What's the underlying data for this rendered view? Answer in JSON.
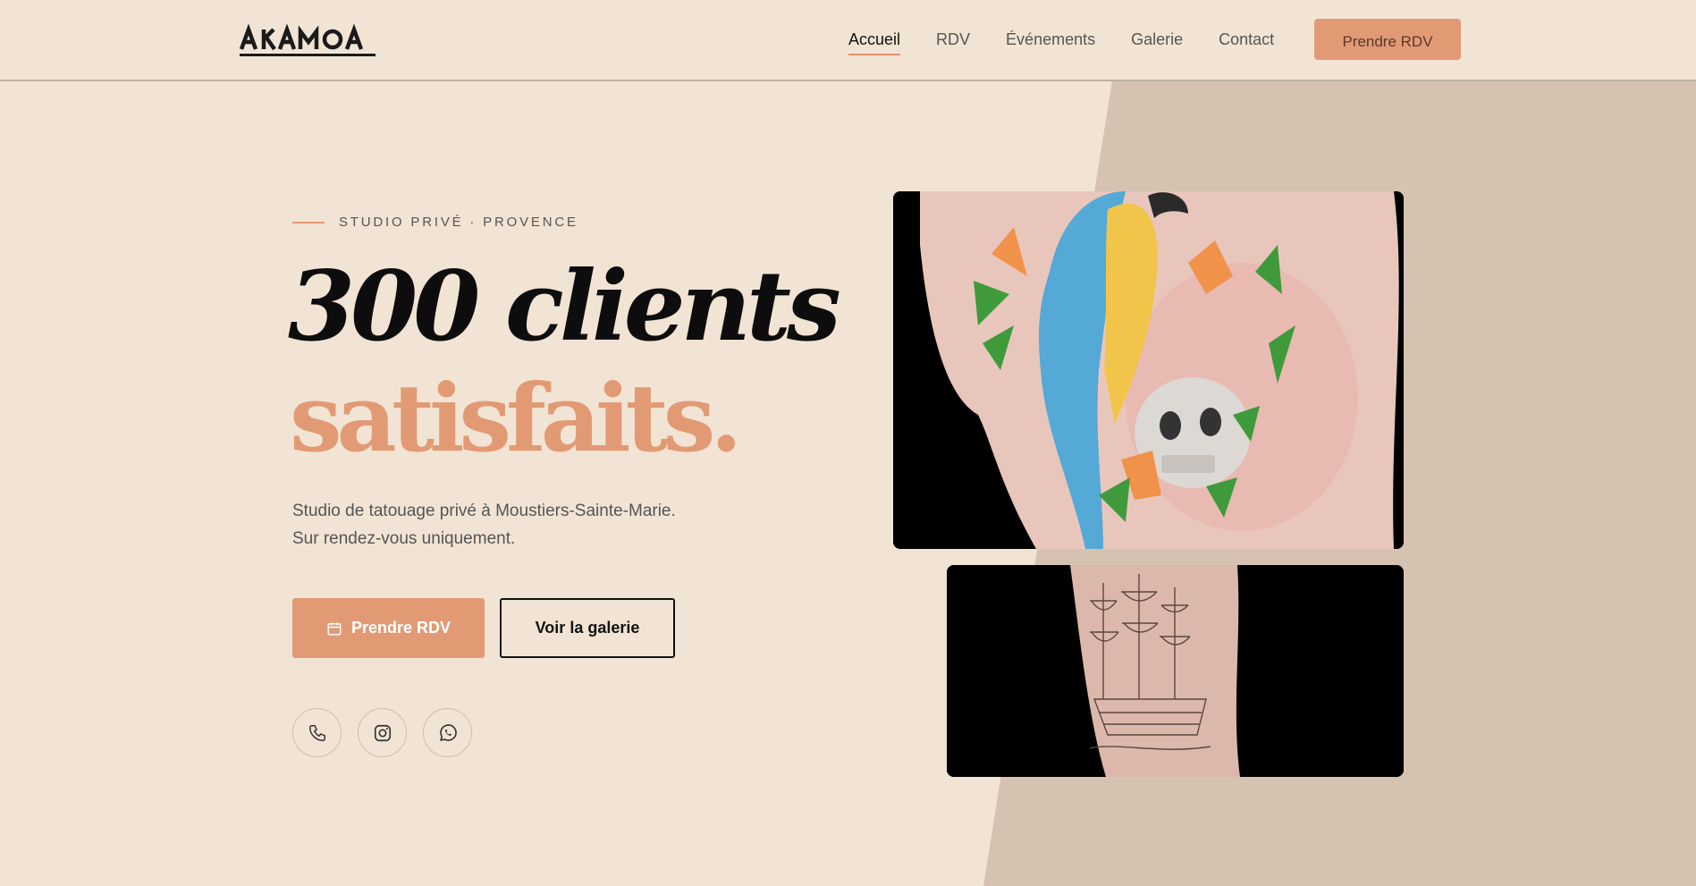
{
  "brand": {
    "logo_text": "AKAMOA"
  },
  "nav": {
    "items": [
      {
        "label": "Accueil",
        "active": true
      },
      {
        "label": "RDV"
      },
      {
        "label": "Événements"
      },
      {
        "label": "Galerie"
      },
      {
        "label": "Contact"
      }
    ],
    "cta_label": "Prendre RDV"
  },
  "hero": {
    "eyebrow": "STUDIO PRIVÉ · PROVENCE",
    "headline_line1": "300 clients",
    "headline_line2": "satisfaits.",
    "description_line1": "Studio de tatouage privé à Moustiers-Sainte-Marie.",
    "description_line2": "Sur rendez-vous uniquement.",
    "primary_button": {
      "label": "Prendre RDV",
      "icon": "calendar-icon"
    },
    "secondary_button": {
      "label": "Voir la galerie"
    },
    "socials": [
      {
        "icon": "phone-icon"
      },
      {
        "icon": "instagram-icon"
      },
      {
        "icon": "whatsapp-icon"
      }
    ]
  },
  "gallery": [
    {
      "subject": "parrot-skull-tattoo-photo"
    },
    {
      "subject": "ship-tattoo-photo"
    }
  ],
  "colors": {
    "background": "#f2e4d4",
    "accent": "#e29a75",
    "slant_panel": "#d5c2b0",
    "text_dark": "#0d0d0d"
  }
}
